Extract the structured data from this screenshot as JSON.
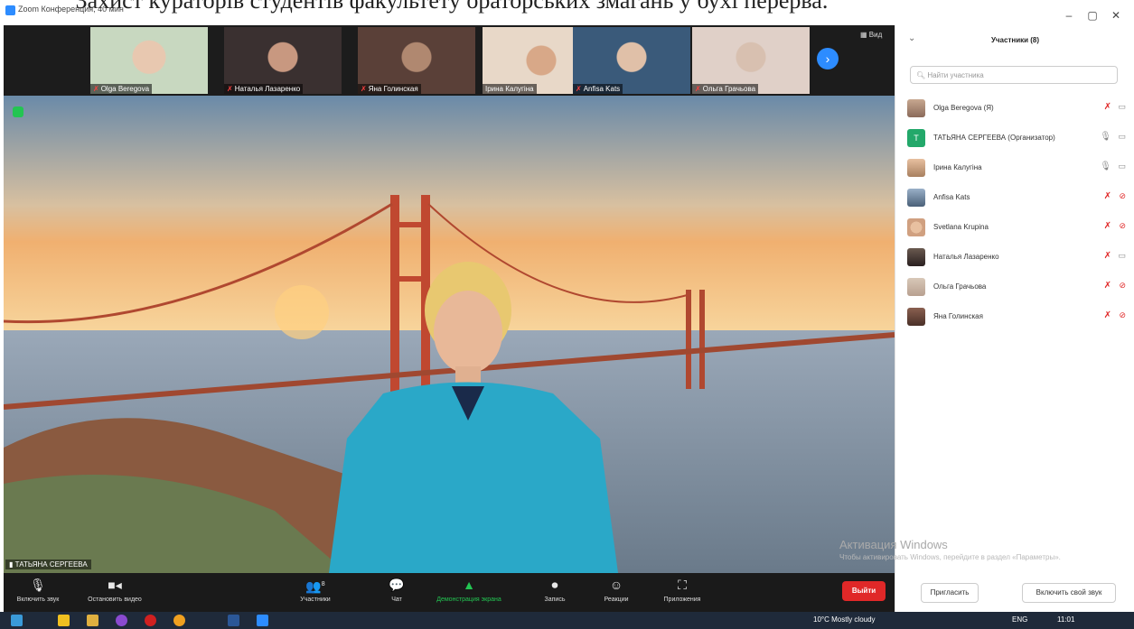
{
  "caption": "Захист кураторів студентів факультету ораторських змагань у бухі перерва.",
  "window": {
    "title": "Zoom Конференция, 40 мин",
    "minimize": "–",
    "maximize": "▢",
    "close": "✕"
  },
  "strip": {
    "view_label": "Вид",
    "next_icon": "›",
    "thumbs": [
      {
        "name": "Olga Beregova",
        "muted": true
      },
      {
        "name": "Наталья Лазаренко",
        "muted": true
      },
      {
        "name": "Яна Голинская",
        "muted": true
      },
      {
        "name": "Ірина Калугіна",
        "muted": false
      },
      {
        "name": "Anfisa Kats",
        "muted": true
      },
      {
        "name": "Ольга Грачьова",
        "muted": true
      }
    ]
  },
  "speaker": {
    "name": "ТАТЬЯНА СЕРГЕЕВА"
  },
  "toolbar": {
    "items": [
      {
        "label": "Включить звук",
        "icon": "mic-off-icon",
        "glyph": "🎙"
      },
      {
        "label": "Остановить видео",
        "icon": "video-icon",
        "glyph": "■"
      },
      {
        "label": "Участники",
        "icon": "participants-icon",
        "glyph": "👥",
        "count": "8"
      },
      {
        "label": "Чат",
        "icon": "chat-icon",
        "glyph": "💬"
      },
      {
        "label": "Демонстрация экрана",
        "icon": "share-screen-icon",
        "glyph": "▲"
      },
      {
        "label": "Запись",
        "icon": "record-icon",
        "glyph": "⏺"
      },
      {
        "label": "Реакции",
        "icon": "reactions-icon",
        "glyph": "☺"
      },
      {
        "label": "Приложения",
        "icon": "apps-icon",
        "glyph": "⛶"
      }
    ],
    "end_label": "Выйти"
  },
  "panel": {
    "collapse_icon": "⌄",
    "title": "Участники (8)",
    "search_placeholder": "Найти участника",
    "participants": [
      {
        "name": "Olga Beregova (Я)",
        "mic": "muted",
        "cam": "on"
      },
      {
        "name": "ТАТЬЯНА СЕРГЕЕВА (Организатор)",
        "mic": "on",
        "cam": "on",
        "initial": "Т"
      },
      {
        "name": "Ірина Калугіна",
        "mic": "on",
        "cam": "on"
      },
      {
        "name": "Anfisa Kats",
        "mic": "muted",
        "cam": "off"
      },
      {
        "name": "Svetlana Krupina",
        "mic": "muted",
        "cam": "off"
      },
      {
        "name": "Наталья Лазаренко",
        "mic": "muted",
        "cam": "on"
      },
      {
        "name": "Ольга Грачьова",
        "mic": "muted",
        "cam": "off"
      },
      {
        "name": "Яна Голинская",
        "mic": "muted",
        "cam": "off"
      }
    ],
    "invite_label": "Пригласить",
    "unmute_label": "Включить свой звук"
  },
  "watermark": {
    "title": "Активация Windows",
    "subtitle": "Чтобы активировать Windows, перейдите в раздел «Параметры»."
  },
  "taskbar": {
    "weather": "10°C  Mostly cloudy",
    "lang": "ENG",
    "time": "11:01"
  },
  "colors": {
    "zoom_blue": "#2d8cff",
    "share_green": "#23c552",
    "end_red": "#e02828"
  }
}
